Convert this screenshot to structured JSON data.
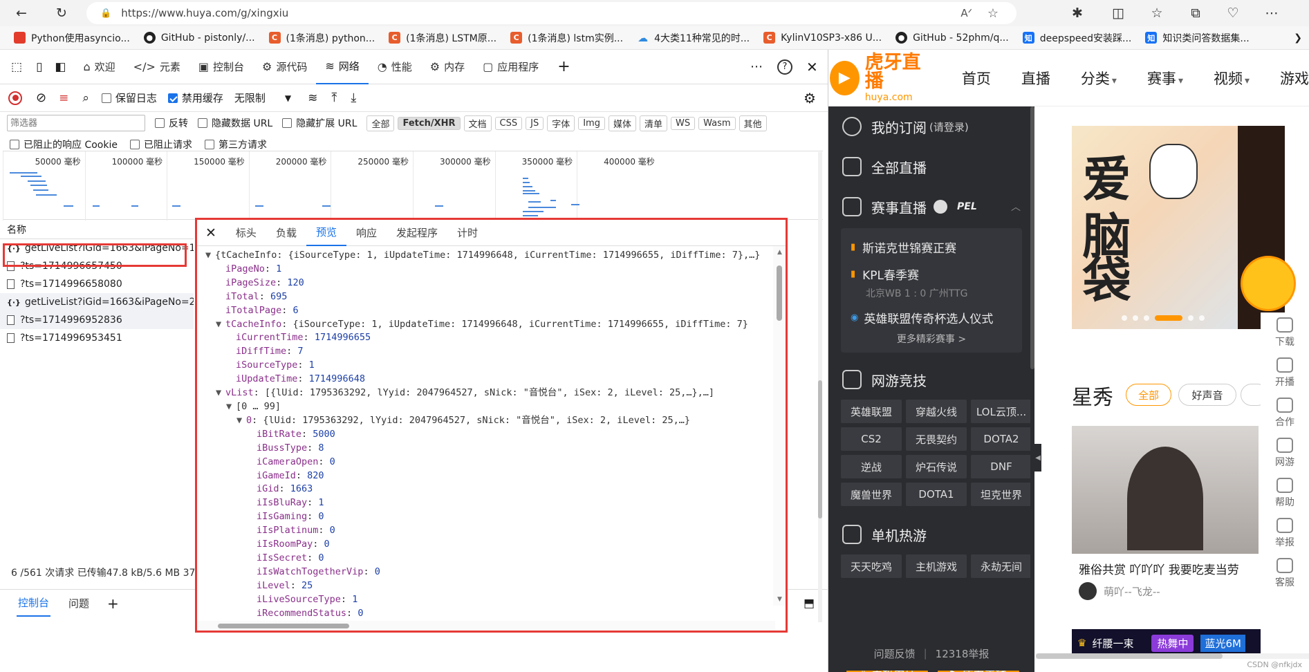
{
  "browser": {
    "url": "https://www.huya.com/g/xingxiu",
    "bookmarks": [
      {
        "label": "Python使用asyncio...",
        "icon": "",
        "color": "#e23c2c"
      },
      {
        "label": "GitHub - pistonly/...",
        "icon": "github-icon",
        "color": "#222"
      },
      {
        "label": "(1条消息) python...",
        "icon": "C",
        "color": "#e85d2d"
      },
      {
        "label": "(1条消息) LSTM原...",
        "icon": "C",
        "color": "#e85d2d"
      },
      {
        "label": "(1条消息) lstm实例...",
        "icon": "C",
        "color": "#e85d2d"
      },
      {
        "label": "4大类11种常见的时...",
        "icon": "cloud-icon",
        "color": "#2f8ae0"
      },
      {
        "label": "KylinV10SP3-x86 U...",
        "icon": "C",
        "color": "#e85d2d"
      },
      {
        "label": "GitHub - 52phm/q...",
        "icon": "github-icon",
        "color": "#222"
      },
      {
        "label": "deepspeed安装踩...",
        "icon": "知",
        "color": "#1772f6"
      },
      {
        "label": "知识类问答数据集...",
        "icon": "知",
        "color": "#1772f6"
      }
    ]
  },
  "devtools": {
    "tabs": [
      {
        "label": "欢迎",
        "icon": "⌂"
      },
      {
        "label": "元素",
        "icon": "</>"
      },
      {
        "label": "控制台",
        "icon": "▣"
      },
      {
        "label": "源代码",
        "icon": "⚙"
      },
      {
        "label": "网络",
        "icon": "≋"
      },
      {
        "label": "性能",
        "icon": "◔"
      },
      {
        "label": "内存",
        "icon": "⚙"
      },
      {
        "label": "应用程序",
        "icon": "▢"
      }
    ],
    "active_tab": "网络",
    "toolbar": {
      "preserve_log": "保留日志",
      "disable_cache": "禁用缓存",
      "throttle": "无限制"
    },
    "filter": {
      "placeholder": "筛选器",
      "invert": "反转",
      "hide_data_url": "隐藏数据 URL",
      "hide_ext_url": "隐藏扩展 URL",
      "types": [
        "全部",
        "Fetch/XHR",
        "文档",
        "CSS",
        "JS",
        "字体",
        "Img",
        "媒体",
        "清单",
        "WS",
        "Wasm",
        "其他"
      ],
      "active_type": "Fetch/XHR"
    },
    "options": {
      "blocked_cookie": "已阻止的响应 Cookie",
      "blocked_req": "已阻止请求",
      "third_party": "第三方请求"
    },
    "timeline_ticks": [
      "50000 毫秒",
      "100000 毫秒",
      "150000 毫秒",
      "200000 毫秒",
      "250000 毫秒",
      "300000 毫秒",
      "350000 毫秒",
      "400000 毫秒"
    ],
    "list_header": "名称",
    "requests": [
      {
        "name": "getLiveList?iGid=1663&iPageNo=1...",
        "type": "xhr"
      },
      {
        "name": "?ts=1714996657450",
        "type": "file"
      },
      {
        "name": "?ts=1714996658080",
        "type": "file"
      },
      {
        "name": "getLiveList?iGid=1663&iPageNo=2...",
        "type": "xhr"
      },
      {
        "name": "?ts=1714996952836",
        "type": "file"
      },
      {
        "name": "?ts=1714996953451",
        "type": "file"
      }
    ],
    "status": "6 /561 次请求  已传输47.8 kB/5.6 MB  37",
    "drawer": {
      "console": "控制台",
      "issues": "问题"
    },
    "detail_tabs": [
      "标头",
      "负载",
      "预览",
      "响应",
      "发起程序",
      "计时"
    ],
    "active_detail_tab": "预览",
    "preview_lines": [
      {
        "indent": 0,
        "arrow": "▼",
        "key": "",
        "text": "{tCacheInfo: {iSourceType: 1, iUpdateTime: 1714996648, iCurrentTime: 1714996655, iDiffTime: 7},…}"
      },
      {
        "indent": 1,
        "arrow": "",
        "key": "iPageNo",
        "text": "1",
        "kind": "n"
      },
      {
        "indent": 1,
        "arrow": "",
        "key": "iPageSize",
        "text": "120",
        "kind": "n"
      },
      {
        "indent": 1,
        "arrow": "",
        "key": "iTotal",
        "text": "695",
        "kind": "n"
      },
      {
        "indent": 1,
        "arrow": "",
        "key": "iTotalPage",
        "text": "6",
        "kind": "n"
      },
      {
        "indent": 1,
        "arrow": "▼",
        "key": "tCacheInfo",
        "text": "{iSourceType: 1, iUpdateTime: 1714996648, iCurrentTime: 1714996655, iDiffTime: 7}",
        "kind": "p"
      },
      {
        "indent": 2,
        "arrow": "",
        "key": "iCurrentTime",
        "text": "1714996655",
        "kind": "n"
      },
      {
        "indent": 2,
        "arrow": "",
        "key": "iDiffTime",
        "text": "7",
        "kind": "n"
      },
      {
        "indent": 2,
        "arrow": "",
        "key": "iSourceType",
        "text": "1",
        "kind": "n"
      },
      {
        "indent": 2,
        "arrow": "",
        "key": "iUpdateTime",
        "text": "1714996648",
        "kind": "n"
      },
      {
        "indent": 1,
        "arrow": "▼",
        "key": "vList",
        "text": "[{lUid: 1795363292, lYyid: 2047964527, sNick: \"音悦台\", iSex: 2, iLevel: 25,…},…]",
        "kind": "p"
      },
      {
        "indent": 2,
        "arrow": "▼",
        "key": "",
        "text": "[0 … 99]",
        "kind": "p"
      },
      {
        "indent": 3,
        "arrow": "▼",
        "key": "0",
        "text": "{lUid: 1795363292, lYyid: 2047964527, sNick: \"音悦台\", iSex: 2, iLevel: 25,…}",
        "kind": "p"
      },
      {
        "indent": 4,
        "arrow": "",
        "key": "iBitRate",
        "text": "5000",
        "kind": "n"
      },
      {
        "indent": 4,
        "arrow": "",
        "key": "iBussType",
        "text": "8",
        "kind": "n"
      },
      {
        "indent": 4,
        "arrow": "",
        "key": "iCameraOpen",
        "text": "0",
        "kind": "n"
      },
      {
        "indent": 4,
        "arrow": "",
        "key": "iGameId",
        "text": "820",
        "kind": "n"
      },
      {
        "indent": 4,
        "arrow": "",
        "key": "iGid",
        "text": "1663",
        "kind": "n"
      },
      {
        "indent": 4,
        "arrow": "",
        "key": "iIsBluRay",
        "text": "1",
        "kind": "n"
      },
      {
        "indent": 4,
        "arrow": "",
        "key": "iIsGaming",
        "text": "0",
        "kind": "n"
      },
      {
        "indent": 4,
        "arrow": "",
        "key": "iIsPlatinum",
        "text": "0",
        "kind": "n"
      },
      {
        "indent": 4,
        "arrow": "",
        "key": "iIsRoomPay",
        "text": "0",
        "kind": "n"
      },
      {
        "indent": 4,
        "arrow": "",
        "key": "iIsSecret",
        "text": "0",
        "kind": "n"
      },
      {
        "indent": 4,
        "arrow": "",
        "key": "iIsWatchTogetherVip",
        "text": "0",
        "kind": "n"
      },
      {
        "indent": 4,
        "arrow": "",
        "key": "iLevel",
        "text": "25",
        "kind": "n"
      },
      {
        "indent": 4,
        "arrow": "",
        "key": "iLiveSourceType",
        "text": "1",
        "kind": "n"
      },
      {
        "indent": 4,
        "arrow": "",
        "key": "iRecommendStatus",
        "text": "0",
        "kind": "n"
      }
    ]
  },
  "huya": {
    "logo_main": "虎牙直播",
    "logo_sub": "huya.com",
    "nav": [
      "首页",
      "直播",
      "分类",
      "赛事",
      "视频",
      "游戏"
    ],
    "side": {
      "subscribe": "我的订阅",
      "subscribe_hint": "(请登录)",
      "all_live": "全部直播",
      "esports_live": "赛事直播",
      "events": [
        "斯诺克世锦赛正赛",
        "KPL春季赛"
      ],
      "match": "北京WB 1 : 0 广州TTG",
      "ceremony": "英雄联盟传奇杯选人仪式",
      "more": "更多精彩赛事 >",
      "online_games": "网游竞技",
      "online_grid": [
        "英雄联盟",
        "穿越火线",
        "LOL云顶...",
        "CS2",
        "无畏契约",
        "DOTA2",
        "逆战",
        "炉石传说",
        "DNF",
        "魔兽世界",
        "DOTA1",
        "坦克世界"
      ],
      "single_games": "单机热游",
      "single_grid": [
        "天天吃鸡",
        "主机游戏",
        "永劫无间"
      ],
      "mobile_btn": "手机虎牙",
      "streamer_btn": "成为主播",
      "feedback": "问题反馈",
      "report": "12318举报"
    },
    "banner_text": "爱 脑袋",
    "section_title": "星秀",
    "section_tabs": [
      "全部",
      "好声音"
    ],
    "stream_title": "雅俗共赏 吖吖吖 我要吃麦当劳",
    "stream_user": "萌吖--飞龙--",
    "promo_left": "纤腰一束",
    "promo_mid": "热舞中",
    "promo_right": "蓝光6M",
    "right_rail": [
      "下载",
      "开播",
      "合作",
      "网游",
      "帮助",
      "举报",
      "客服"
    ],
    "watermark": "CSDN @nfkjdx"
  }
}
